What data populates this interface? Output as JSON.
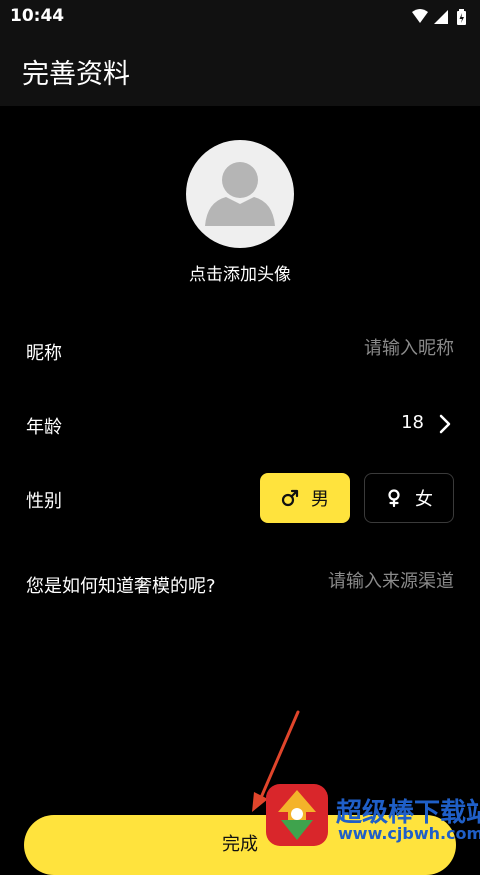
{
  "status_bar": {
    "time": "10:44"
  },
  "app_bar": {
    "title": "完善资料"
  },
  "avatar": {
    "caption": "点击添加头像"
  },
  "form": {
    "nickname": {
      "label": "昵称",
      "placeholder": "请输入昵称"
    },
    "age": {
      "label": "年龄",
      "value": "18"
    },
    "gender": {
      "label": "性别",
      "male_label": "男",
      "female_label": "女",
      "selected": "男"
    },
    "source": {
      "label": "您是如何知道奢模的呢?",
      "placeholder": "请输入来源渠道"
    }
  },
  "complete_button": {
    "label": "完成"
  },
  "watermark": {
    "title": "超级棒下载站",
    "url": "www.cjbwh.com"
  },
  "colors": {
    "accent": "#ffe33d",
    "background": "#000000",
    "bar": "#111111",
    "annotation": "#e0452b"
  }
}
